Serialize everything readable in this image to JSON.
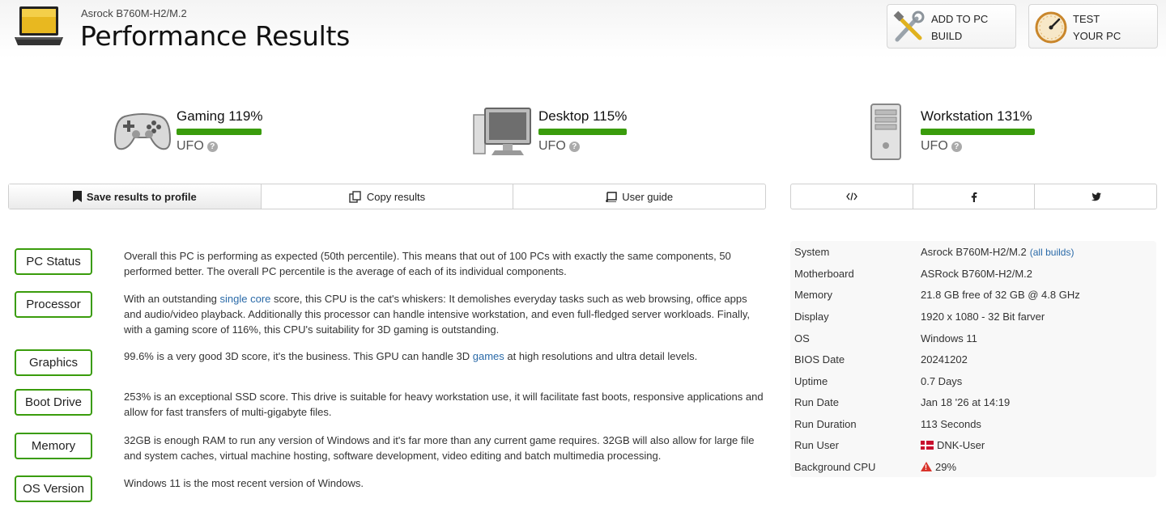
{
  "header": {
    "subtitle": "Asrock B760M-H2/M.2",
    "title": "Performance Results",
    "add_build": {
      "line1": "ADD TO PC",
      "line2": "BUILD",
      "icon": "tools-icon"
    },
    "test_pc": {
      "line1": "TEST",
      "line2": "YOUR PC",
      "icon": "speedometer-icon"
    }
  },
  "categories": [
    {
      "name": "Gaming 119%",
      "label": "UFO",
      "icon": "gamepad-icon",
      "percent": 119
    },
    {
      "name": "Desktop 115%",
      "label": "UFO",
      "icon": "monitor-icon",
      "percent": 115
    },
    {
      "name": "Workstation 131%",
      "label": "UFO",
      "icon": "server-tower-icon",
      "percent": 131
    }
  ],
  "actions": {
    "save": "Save results to profile",
    "copy": "Copy results",
    "guide": "User guide"
  },
  "share": {
    "embed_icon": "code-icon",
    "facebook_icon": "facebook-icon",
    "twitter_icon": "twitter-icon"
  },
  "components": [
    {
      "label": "PC Status",
      "text": "Overall this PC is performing as expected (50th percentile). This means that out of 100 PCs with exactly the same components, 50 performed better. The overall PC percentile is the average of each of its individual components."
    },
    {
      "label": "Processor",
      "pre": "With an outstanding ",
      "link": "single core",
      "post": " score, this CPU is the cat's whiskers: It demolishes everyday tasks such as web browsing, office apps and audio/video playback. Additionally this processor can handle intensive workstation, and even full-fledged server workloads. Finally, with a gaming score of 116%, this CPU's suitability for 3D gaming is outstanding."
    },
    {
      "label": "Graphics",
      "pre": "99.6% is a very good 3D score, it's the business. This GPU can handle 3D ",
      "link": "games",
      "post": " at high resolutions and ultra detail levels."
    },
    {
      "label": "Boot Drive",
      "text": "253% is an exceptional SSD score. This drive is suitable for heavy workstation use, it will facilitate fast boots, responsive applications and allow for fast transfers of multi-gigabyte files."
    },
    {
      "label": "Memory",
      "text": "32GB is enough RAM to run any version of Windows and it's far more than any current game requires. 32GB will also allow for large file and system caches, virtual machine hosting, software development, video editing and batch multimedia processing."
    },
    {
      "label": "OS Version",
      "text": "Windows 11 is the most recent version of Windows."
    }
  ],
  "specs": [
    {
      "key": "System",
      "value": "Asrock B760M-H2/M.2",
      "link": "(all builds)"
    },
    {
      "key": "Motherboard",
      "value": "ASRock B760M-H2/M.2"
    },
    {
      "key": "Memory",
      "value": "21.8 GB free of 32 GB @ 4.8 GHz"
    },
    {
      "key": "Display",
      "value": "1920 x 1080 - 32 Bit farver"
    },
    {
      "key": "OS",
      "value": "Windows 11"
    },
    {
      "key": "BIOS Date",
      "value": "20241202"
    },
    {
      "key": "Uptime",
      "value": "0.7 Days"
    },
    {
      "key": "Run Date",
      "value": "Jan 18 '26 at 14:19"
    },
    {
      "key": "Run Duration",
      "value": "113 Seconds"
    },
    {
      "key": "Run User",
      "value": "DNK-User",
      "icon": "denmark-flag-icon"
    },
    {
      "key": "Background CPU",
      "value": "29%",
      "icon": "warning-icon"
    }
  ]
}
